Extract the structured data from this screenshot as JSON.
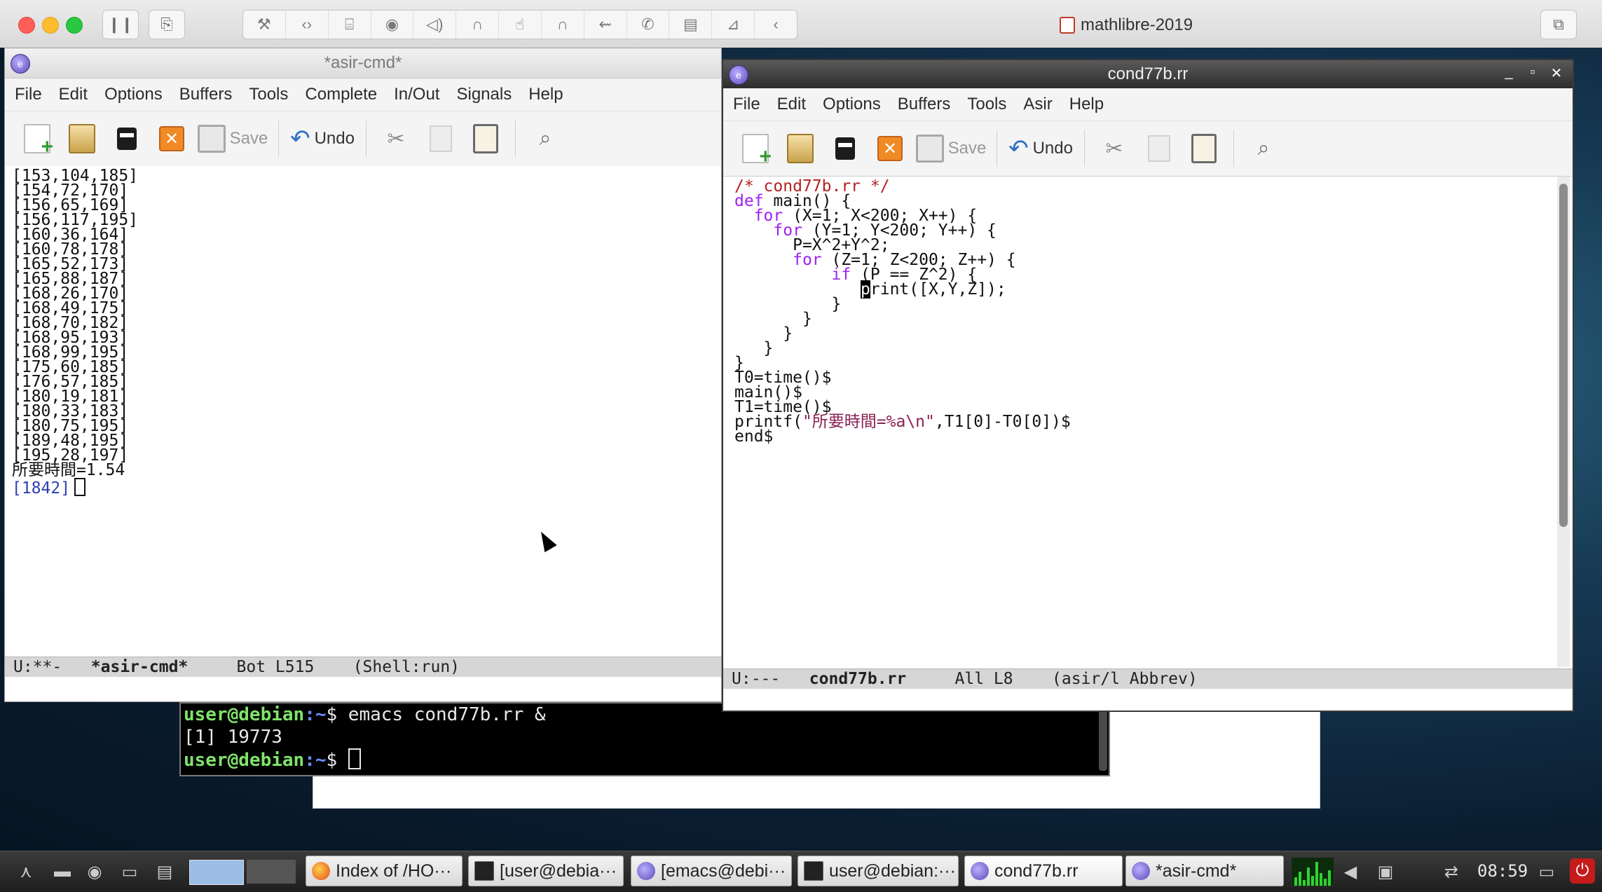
{
  "mac": {
    "window_title": "mathlibre-2019",
    "toolbar_icons": [
      "pause-icon",
      "snapshot-icon",
      "wrench-icon",
      "code-icon",
      "drive-icon",
      "camera-icon",
      "speaker-icon",
      "headphone-icon",
      "mouse-icon",
      "headset-icon",
      "usb-icon",
      "phone-icon",
      "printer-icon",
      "folder-icon",
      "chevron-left-icon"
    ]
  },
  "left_window": {
    "title": "*asir-cmd*",
    "menu": [
      "File",
      "Edit",
      "Options",
      "Buffers",
      "Tools",
      "Complete",
      "In/Out",
      "Signals",
      "Help"
    ],
    "toolbar": {
      "save": "Save",
      "undo": "Undo"
    },
    "output": [
      "[153,104,185]",
      "[154,72,170]",
      "[156,65,169]",
      "[156,117,195]",
      "[160,36,164]",
      "[160,78,178]",
      "[165,52,173]",
      "[165,88,187]",
      "[168,26,170]",
      "[168,49,175]",
      "[168,70,182]",
      "[168,95,193]",
      "[168,99,195]",
      "[175,60,185]",
      "[176,57,185]",
      "[180,19,181]",
      "[180,33,183]",
      "[180,75,195]",
      "[189,48,195]",
      "[195,28,197]",
      "所要時間=1.54"
    ],
    "prompt": "[1842]",
    "modeline": {
      "state": "U:**-",
      "buffer": "*asir-cmd*",
      "position": "Bot L515",
      "mode": "(Shell:run)"
    }
  },
  "right_window": {
    "title": "cond77b.rr",
    "controls": [
      "_",
      "▫",
      "✕"
    ],
    "menu": [
      "File",
      "Edit",
      "Options",
      "Buffers",
      "Tools",
      "Asir",
      "Help"
    ],
    "toolbar": {
      "save": "Save",
      "undo": "Undo"
    },
    "code": {
      "l1_comment": "/* cond77b.rr */",
      "l2_kw": "def",
      "l2_rest": " main() {",
      "l3_kw": "for",
      "l3_rest": " (X=1; X<200; X++) {",
      "l4_kw": "for",
      "l4_rest": " (Y=1; Y<200; Y++) {",
      "l5": "P=X^2+Y^2;",
      "l6_kw": "for",
      "l6_rest": " (Z=1; Z<200; Z++) {",
      "l7_kw": "if",
      "l7_rest": " (P == Z^2) {",
      "l8_cursor": "p",
      "l8_rest": "rint([X,Y,Z]);",
      "l9": "}",
      "l10": "}",
      "l11": "}",
      "l12": "}",
      "l13": "}",
      "l14": "T0=time()$",
      "l15": "main()$",
      "l16": "T1=time()$",
      "l17_pre": "printf(",
      "l17_str": "\"所要時間=%a\\n\"",
      "l17_post": ",T1[0]-T0[0])$",
      "l18": "end$"
    },
    "modeline": {
      "state": "U:---",
      "buffer": "cond77b.rr",
      "position": "All L8",
      "mode": "(asir/l Abbrev)"
    }
  },
  "terminal": {
    "line1_user": "user@debian",
    "line1_path": ":~",
    "line1_cmd": "$ emacs cond77b.rr &",
    "line2": "[1] 19773",
    "line3_user": "user@debian",
    "line3_path": ":~",
    "line3_cmd": "$ "
  },
  "taskbar": {
    "tasks": [
      {
        "label": "Index of /HO···",
        "icon": "firefox-icon"
      },
      {
        "label": "[user@debia···",
        "icon": "terminal-icon"
      },
      {
        "label": "[emacs@debi···",
        "icon": "emacs-icon"
      },
      {
        "label": "user@debian:···",
        "icon": "terminal-icon"
      },
      {
        "label": "cond77b.rr",
        "icon": "emacs-icon"
      },
      {
        "label": "*asir-cmd*",
        "icon": "emacs-icon"
      }
    ],
    "clock": "08:59"
  }
}
